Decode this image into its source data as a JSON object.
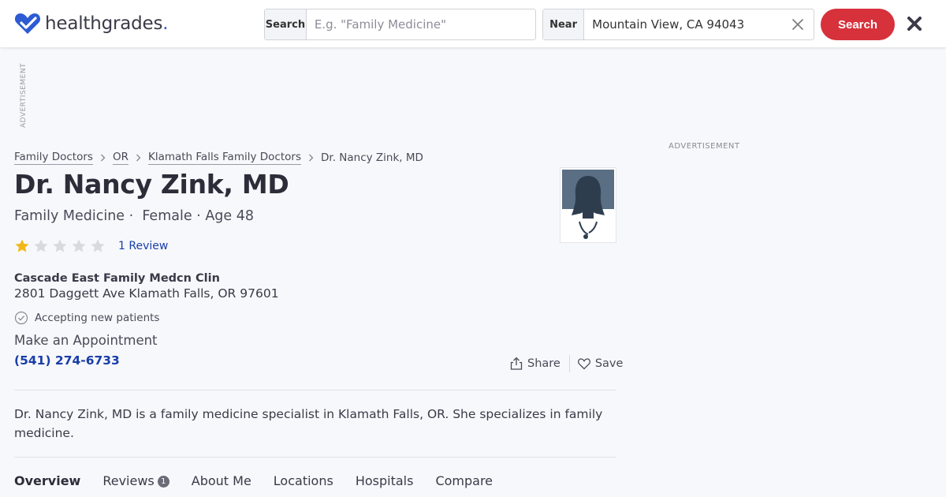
{
  "header": {
    "logo_text": "healthgrades",
    "logo_dot": ".",
    "search_label": "Search",
    "search_placeholder": "E.g. \"Family Medicine\"",
    "near_label": "Near",
    "near_value": "Mountain View, CA 94043",
    "search_button": "Search"
  },
  "ads": {
    "left_label": "ADVERTISEMENT",
    "right_label": "ADVERTISEMENT"
  },
  "breadcrumb": {
    "items": [
      "Family Doctors",
      "OR",
      "Klamath Falls Family Doctors"
    ],
    "current": "Dr. Nancy Zink, MD"
  },
  "doctor": {
    "name": "Dr. Nancy Zink, MD",
    "specialty": "Family Medicine",
    "gender": "Female",
    "age": "Age 48",
    "rating": 1,
    "rating_max": 5,
    "review_link": "1 Review",
    "practice": "Cascade East Family Medcn Clin",
    "address": "2801 Daggett Ave Klamath Falls, OR 97601",
    "accepting": "Accepting new patients",
    "appointment_label": "Make an Appointment",
    "phone": "(541) 274-6733",
    "description": "Dr. Nancy Zink, MD is a family medicine specialist in Klamath Falls, OR. She specializes in family medicine."
  },
  "actions": {
    "share": "Share",
    "save": "Save"
  },
  "tabs": [
    {
      "label": "Overview",
      "active": true
    },
    {
      "label": "Reviews",
      "badge": "1"
    },
    {
      "label": "About Me"
    },
    {
      "label": "Locations"
    },
    {
      "label": "Hospitals"
    },
    {
      "label": "Compare"
    }
  ],
  "colors": {
    "brand_blue": "#2d5bd3",
    "search_red": "#d7313b",
    "link_blue": "#1a3ea8",
    "star_gold": "#f2b81a",
    "star_empty": "#d9dade"
  }
}
